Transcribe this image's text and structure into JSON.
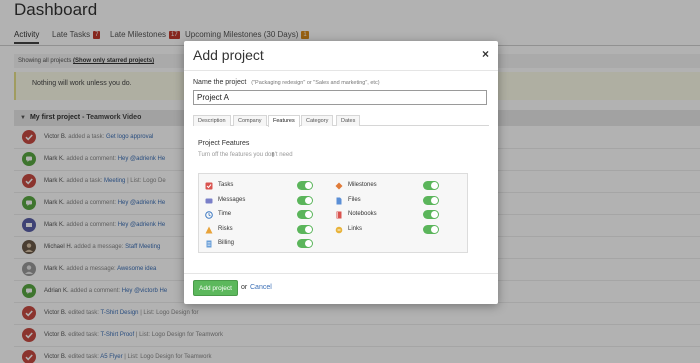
{
  "page": {
    "title": "Dashboard",
    "tabs": [
      {
        "label": "Activity"
      },
      {
        "label": "Late Tasks",
        "badge": "7"
      },
      {
        "label": "Late Milestones",
        "badge": "17"
      },
      {
        "label": "Upcoming Milestones (30 Days)",
        "badge": "1"
      }
    ],
    "showing": {
      "text": "Showing all projects",
      "link": "(Show only starred projects)"
    },
    "notice": "Nothing will work unless you do.",
    "project": {
      "name": "My first project",
      "sub": "- Teamwork Video"
    },
    "activity": [
      {
        "type": "task",
        "who": "Victor B.",
        "what": "added a task:",
        "link": "Get logo approval"
      },
      {
        "type": "comment",
        "who": "Mark K.",
        "what": "added a comment:",
        "link": "Hey @adrienk He"
      },
      {
        "type": "task",
        "who": "Mark K.",
        "what": "added a task:",
        "link": "Meeting",
        "extra": "| List: Logo De"
      },
      {
        "type": "comment",
        "who": "Mark K.",
        "what": "added a comment:",
        "link": "Hey @adrienk He"
      },
      {
        "type": "message",
        "who": "Mark K.",
        "what": "added a comment:",
        "link": "Hey @adrienk He"
      },
      {
        "type": "photo",
        "who": "Michael H.",
        "what": "added a message:",
        "link": "Staff Meeting"
      },
      {
        "type": "photo2",
        "who": "Mark K.",
        "what": "added a message:",
        "link": "Awesome idea"
      },
      {
        "type": "comment",
        "who": "Adrian K.",
        "what": "added a comment:",
        "link": "Hey @victorb He"
      },
      {
        "type": "task",
        "who": "Victor B.",
        "what": "edited task:",
        "link": "T-Shirt Design",
        "extra": "| List: Logo Design for"
      },
      {
        "type": "task",
        "who": "Victor B.",
        "what": "edited task:",
        "link": "T-Shirt Proof",
        "extra": "| List: Logo Design for Teamwork"
      },
      {
        "type": "task",
        "who": "Victor B.",
        "what": "edited task:",
        "link": "A5 Flyer",
        "extra": "| List: Logo Design for Teamwork"
      }
    ]
  },
  "modal": {
    "title": "Add project",
    "close": "×",
    "name_label": "Name the project",
    "name_hint": "(\"Packaging redesign\" or \"Sales and marketing\", etc)",
    "name_value": "Project A",
    "tabs": [
      "Description",
      "Company",
      "Features",
      "Category",
      "Dates"
    ],
    "active_tab": "Features",
    "features_title": "Project Features",
    "features_sub": "Turn off the features you don't need",
    "features_left": [
      {
        "label": "Tasks",
        "icon": "tasks-icon",
        "color": "#d9534f",
        "on": true
      },
      {
        "label": "Messages",
        "icon": "messages-icon",
        "color": "#7a7fc8",
        "on": true
      },
      {
        "label": "Time",
        "icon": "time-icon",
        "color": "#3b78c2",
        "on": true
      },
      {
        "label": "Risks",
        "icon": "risks-icon",
        "color": "#e8a33a",
        "on": true
      },
      {
        "label": "Billing",
        "icon": "billing-icon",
        "color": "#6a9fd8",
        "on": true
      }
    ],
    "features_right": [
      {
        "label": "Milestones",
        "icon": "milestones-icon",
        "color": "#e07b39",
        "on": true
      },
      {
        "label": "Files",
        "icon": "files-icon",
        "color": "#5b8fd6",
        "on": true
      },
      {
        "label": "Notebooks",
        "icon": "notebooks-icon",
        "color": "#d9534f",
        "on": true
      },
      {
        "label": "Links",
        "icon": "links-icon",
        "color": "#e8b33a",
        "on": true
      }
    ],
    "submit_label": "Add project",
    "or_text": "or",
    "cancel_label": "Cancel"
  }
}
